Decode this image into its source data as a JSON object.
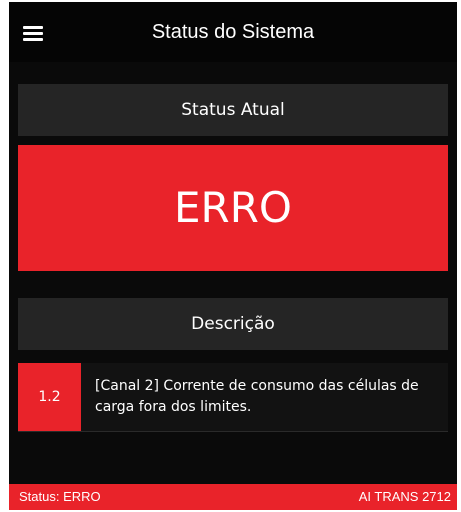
{
  "header": {
    "title": "Status do Sistema",
    "menu_icon": "hamburger-menu-icon"
  },
  "status_panel": {
    "header": "Status Atual",
    "value": "ERRO",
    "color": "#e9232a"
  },
  "description_panel": {
    "header": "Descrição",
    "items": [
      {
        "code": "1.2",
        "text": "[Canal 2] Corrente de consumo das células de carga fora dos limites."
      }
    ]
  },
  "status_bar": {
    "left": "Status: ERRO",
    "right": "AI TRANS 2712"
  },
  "colors": {
    "background": "#0a0a0a",
    "panel": "#252525",
    "accent_error": "#e9232a"
  }
}
